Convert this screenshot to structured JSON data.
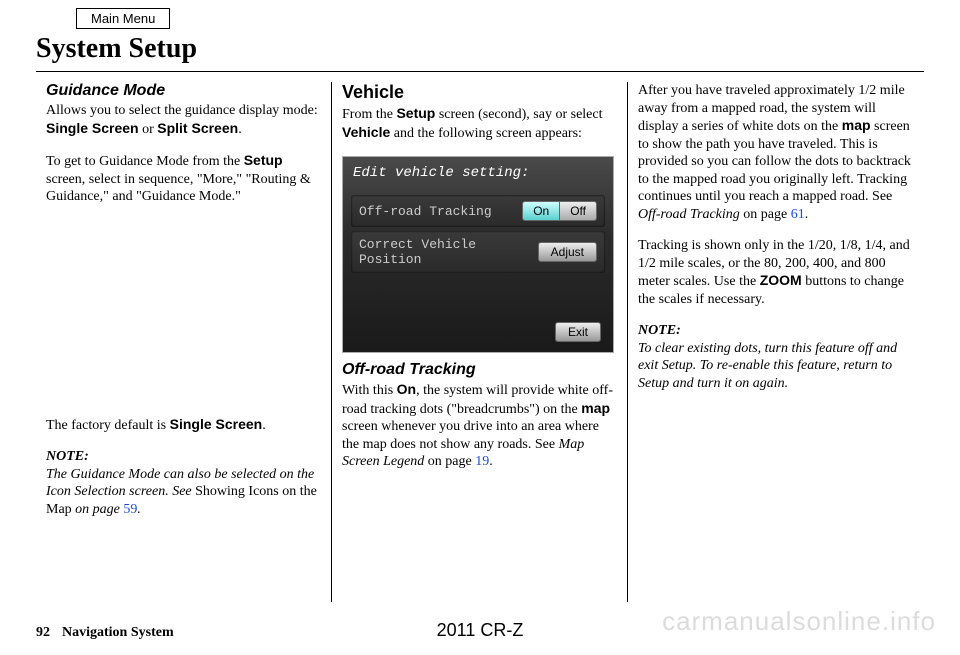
{
  "main_menu_label": "Main Menu",
  "page_title": "System Setup",
  "col1": {
    "h_guidance": "Guidance Mode",
    "p1_a": "Allows you to select the guidance display mode: ",
    "p1_b1": "Single Screen",
    "p1_or": " or ",
    "p1_b2": "Split Screen",
    "p1_end": ".",
    "p2_a": "To get to Guidance Mode from the ",
    "p2_b": "Setup",
    "p2_c": " screen, select in sequence, \"More,\" \"Routing & Guidance,\" and \"Guidance Mode.\"",
    "p3_a": "The factory default is ",
    "p3_b": "Single Screen",
    "p3_end": ".",
    "note_label": "NOTE:",
    "note_a": "The Guidance Mode can also be selected on the Icon Selection screen. See ",
    "note_b": "Showing Icons on the Map",
    "note_c": " on page ",
    "note_link": "59",
    "note_end": "."
  },
  "col2": {
    "h_vehicle": "Vehicle",
    "p1_a": "From the ",
    "p1_b": "Setup",
    "p1_c": " screen (second), say or select ",
    "p1_d": "Vehicle",
    "p1_e": " and the following screen appears:",
    "nav": {
      "header": "Edit vehicle setting:",
      "row1_label": "Off-road Tracking",
      "row1_on": "On",
      "row1_off": "Off",
      "row2_label": "Correct Vehicle Position",
      "row2_btn": "Adjust",
      "exit": "Exit"
    },
    "h_offroad": "Off-road Tracking",
    "p2_a": "With this ",
    "p2_b": "On",
    "p2_c": ", the system will provide white off-road tracking dots (\"breadcrumbs\") on the ",
    "p2_d": "map",
    "p2_e": " screen whenever you drive into an area where the map does not show any roads. See ",
    "p2_f": "Map Screen Legend",
    "p2_g": " on page ",
    "p2_link": "19",
    "p2_end": "."
  },
  "col3": {
    "p1_a": "After you have traveled approximately 1/2 mile away from a mapped road, the system will display a series of white dots on the ",
    "p1_b": "map",
    "p1_c": " screen to show the path you have traveled. This is provided so you can follow the dots to backtrack to the mapped road you originally left. Tracking continues until you reach a mapped road. See ",
    "p1_d": "Off-road Tracking",
    "p1_e": " on page ",
    "p1_link": "61",
    "p1_end": ".",
    "p2_a": "Tracking is shown only in the 1/20, 1/8, 1/4, and 1/2 mile scales, or the 80, 200, 400, and 800 meter scales. Use the ",
    "p2_b": "ZOOM",
    "p2_c": " buttons to change the scales if necessary.",
    "note_label": "NOTE:",
    "note_body": "To clear existing dots, turn this feature off and exit Setup. To re-enable this feature, return to Setup and turn it on again."
  },
  "footer": {
    "page_no": "92",
    "section": "Navigation System",
    "model": "2011 CR-Z"
  },
  "watermark": "carmanualsonline.info"
}
